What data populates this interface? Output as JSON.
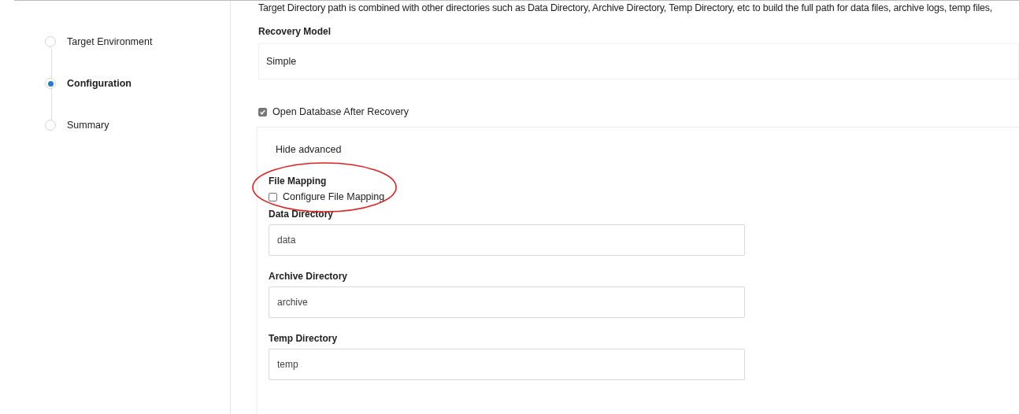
{
  "steps": [
    {
      "label": "Target Environment",
      "selected": false
    },
    {
      "label": "Configuration",
      "selected": true
    },
    {
      "label": "Summary",
      "selected": false
    }
  ],
  "description": "Target Directory path is combined with other directories such as Data Directory, Archive Directory, Temp Directory, etc to build the full path for data files, archive logs, temp files,",
  "recovery_model": {
    "label": "Recovery Model",
    "value": "Simple"
  },
  "open_database": {
    "label": "Open Database After Recovery",
    "checked": true
  },
  "advanced": {
    "toggle": "Hide advanced",
    "file_mapping": {
      "label": "File Mapping",
      "option": "Configure File Mapping",
      "checked": false
    },
    "fields": [
      {
        "label": "Data Directory",
        "value": "data"
      },
      {
        "label": "Archive Directory",
        "value": "archive"
      },
      {
        "label": "Temp Directory",
        "value": "temp"
      }
    ]
  },
  "annotation": {
    "kind": "ellipse"
  }
}
